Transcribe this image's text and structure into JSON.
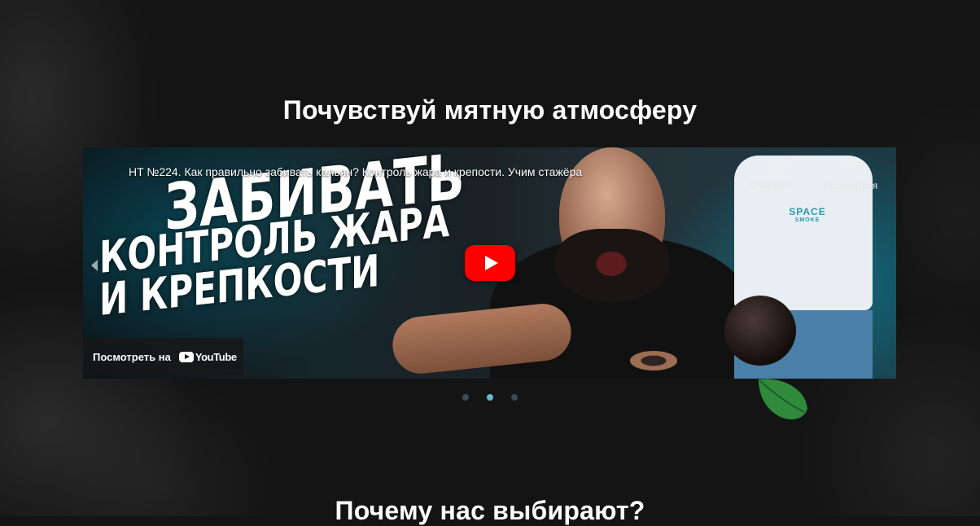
{
  "section_titles": {
    "atmosphere": "Почувствуй мятную атмосферу",
    "why_us": "Почему нас выбирают?"
  },
  "video": {
    "title": "HT №224. Как правильно забивать кальян? Контроль жара и крепости. Учим стажёра",
    "thumbnail_text": [
      "ЗАБИВАТЬ",
      "КОНТРОЛЬ ЖАРА",
      "И КРЕПКОСТИ"
    ],
    "shirt_logo": "SPACE",
    "shirt_logo_sub": "SMOKE",
    "watch_later_label": "Смотреть ...",
    "share_label": "Поделиться",
    "watch_on_label": "Посмотреть на",
    "youtube_label": "YouTube"
  },
  "carousel": {
    "slides": 3,
    "active_index": 1
  },
  "colors": {
    "background": "#141414",
    "accent_dot": "#66b8d0",
    "play_red": "#ff0000",
    "leaf_green": "#2f8a3b"
  },
  "icons": [
    "clock-icon",
    "share-icon",
    "play-icon",
    "youtube-logo-icon",
    "mint-leaf-icon"
  ]
}
